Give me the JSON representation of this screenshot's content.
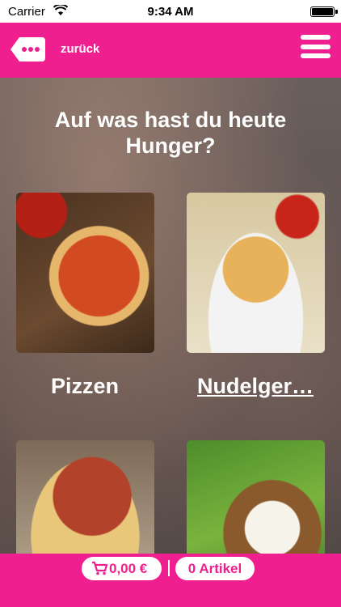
{
  "status_bar": {
    "carrier": "Carrier",
    "time": "9:34 AM",
    "wifi_icon": "wifi-icon",
    "battery_icon": "battery-icon"
  },
  "nav": {
    "back_icon": "speech-bubble-dots-icon",
    "back_label": "zurück",
    "menu_icon": "hamburger-menu-icon"
  },
  "main": {
    "headline": "Auf was hast du heute Hunger?",
    "categories": [
      {
        "label": "Pizzen",
        "image": "pizza-image"
      },
      {
        "label": "Nudelger…",
        "image": "pasta-image"
      },
      {
        "label": "",
        "image": "spaghetti-image"
      },
      {
        "label": "",
        "image": "baked-potato-image"
      }
    ]
  },
  "cart": {
    "cart_icon": "shopping-cart-icon",
    "price": "0,00 €",
    "articles": "0 Artikel"
  },
  "colors": {
    "accent": "#ef1f8f",
    "status_bar_bg": "#ffffff"
  }
}
